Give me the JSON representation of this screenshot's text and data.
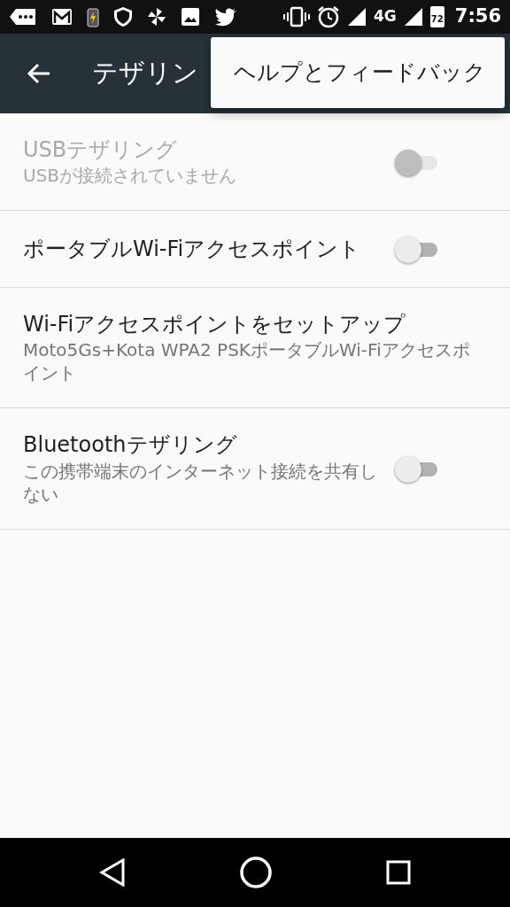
{
  "status_bar": {
    "network": "4G",
    "battery": "72",
    "time": "7:56"
  },
  "app_bar": {
    "title": "テザリン"
  },
  "menu": {
    "items": [
      {
        "label": "ヘルプとフィードバック"
      }
    ]
  },
  "settings": [
    {
      "kind": "switch",
      "title": "USBテザリング",
      "summary": "USBが接続されていません",
      "disabled": true,
      "on": false
    },
    {
      "kind": "switch",
      "title": "ポータブルWi-Fiアクセスポイント",
      "disabled": false,
      "on": false
    },
    {
      "kind": "plain",
      "title": "Wi-Fiアクセスポイントをセットアップ",
      "summary": "Moto5Gs+Kota WPA2 PSKポータブルWi-Fiアクセスポイント",
      "disabled": false
    },
    {
      "kind": "switch",
      "title": "Bluetoothテザリング",
      "summary": "この携帯端末のインターネット接続を共有しない",
      "disabled": false,
      "on": false
    }
  ]
}
